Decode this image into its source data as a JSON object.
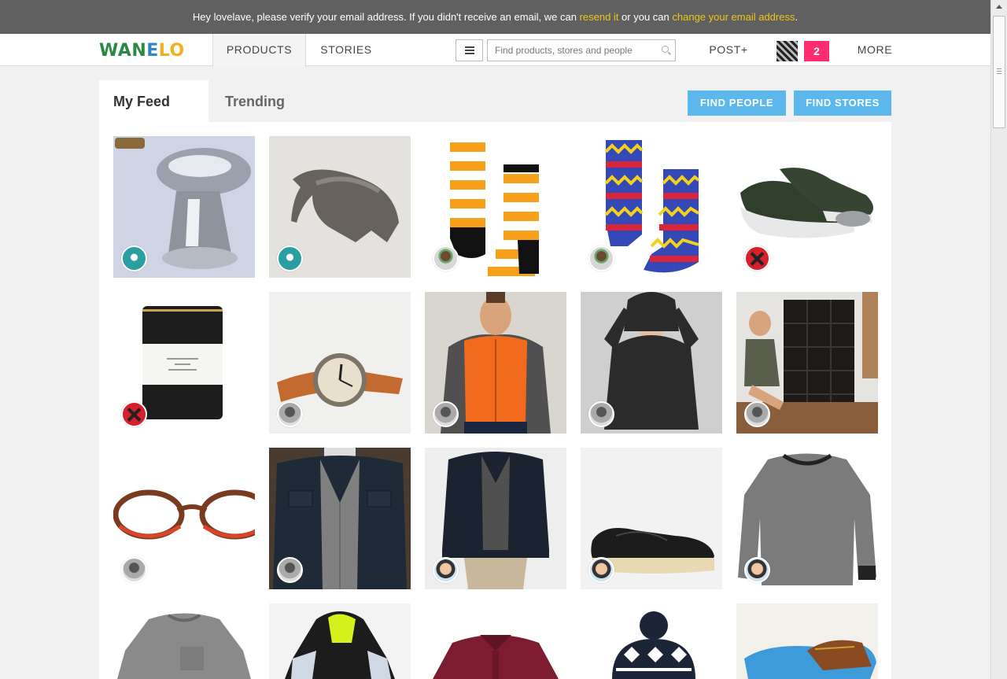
{
  "banner": {
    "text_before": "Hey lovelave, please verify your email address. If you didn't receive an email, we can ",
    "resend_link": "resend it",
    "text_middle": " or you can ",
    "change_link": "change your email address",
    "text_after": "."
  },
  "nav": {
    "logo_letters": [
      {
        "char": "W",
        "color": "#2a8a45"
      },
      {
        "char": "A",
        "color": "#2a8a45"
      },
      {
        "char": "N",
        "color": "#2a8a45"
      },
      {
        "char": "E",
        "color": "#2e86c9"
      },
      {
        "char": "L",
        "color": "#f0b21c"
      },
      {
        "char": "O",
        "color": "#f0b21c"
      }
    ],
    "products_tab": "PRODUCTS",
    "stories_tab": "STORIES",
    "search_placeholder": "Find products, stores and people",
    "post_label": "POST+",
    "notification_count": "2",
    "more_label": "MORE"
  },
  "feed": {
    "my_feed_tab": "My Feed",
    "trending_tab": "Trending",
    "find_people_button": "FIND PEOPLE",
    "find_stores_button": "FIND STORES"
  },
  "products": [
    {
      "name": "chrome-pencil-sharpener",
      "saver": "teal"
    },
    {
      "name": "anteater-bottle-opener",
      "saver": "teal"
    },
    {
      "name": "orange-striped-socks",
      "saver": "person"
    },
    {
      "name": "colorful-pattern-socks",
      "saver": "person"
    },
    {
      "name": "green-leather-sneakers",
      "saver": "x"
    },
    {
      "name": "scented-candle",
      "saver": "x"
    },
    {
      "name": "leather-strap-watch",
      "saver": "grey"
    },
    {
      "name": "orange-puffer-vest",
      "saver": "grey"
    },
    {
      "name": "black-cowl-sweater",
      "saver": "grey"
    },
    {
      "name": "shoe-storage-cubes",
      "saver": "grey"
    },
    {
      "name": "tortoise-glasses",
      "saver": "grey"
    },
    {
      "name": "navy-jacket",
      "saver": "grey"
    },
    {
      "name": "waxed-jacket",
      "saver": "guy"
    },
    {
      "name": "black-low-sneakers",
      "saver": "guy"
    },
    {
      "name": "grey-sweatshirt",
      "saver": "guy"
    },
    {
      "name": "heather-sweatshirt",
      "saver": "none"
    },
    {
      "name": "running-windbreaker",
      "saver": "none"
    },
    {
      "name": "burgundy-polo",
      "saver": "none"
    },
    {
      "name": "knit-beanie",
      "saver": "none"
    },
    {
      "name": "brogue-shoes",
      "saver": "none"
    }
  ]
}
